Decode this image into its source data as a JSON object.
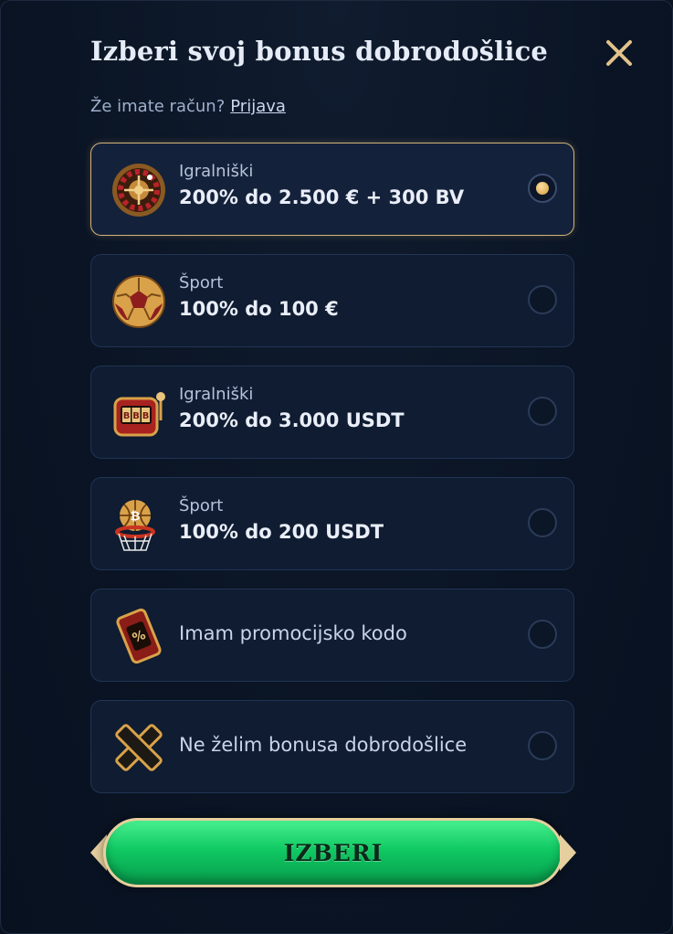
{
  "modal": {
    "title": "Izberi svoj bonus dobrodošlice",
    "login_prompt": "Že imate račun?",
    "login_link": "Prijava"
  },
  "options": [
    {
      "icon": "roulette-icon",
      "label": "Igralniški",
      "value": "200% do 2.500 € + 300 BV",
      "selected": true
    },
    {
      "icon": "soccer-ball-icon",
      "label": "Šport",
      "value": "100% do 100 €",
      "selected": false
    },
    {
      "icon": "slot-machine-icon",
      "label": "Igralniški",
      "value": "200% do 3.000 USDT",
      "selected": false
    },
    {
      "icon": "basketball-hoop-icon",
      "label": "Šport",
      "value": "100% do 200 USDT",
      "selected": false
    },
    {
      "icon": "promo-ticket-icon",
      "text": "Imam promocijsko kodo",
      "selected": false
    },
    {
      "icon": "cross-icon",
      "text": "Ne želim bonusa dobrodošlice",
      "selected": false
    }
  ],
  "cta": {
    "label": "IZBERI"
  },
  "colors": {
    "accent_gold": "#d4b47a",
    "cta_green": "#10c963",
    "background": "#0a1424"
  }
}
